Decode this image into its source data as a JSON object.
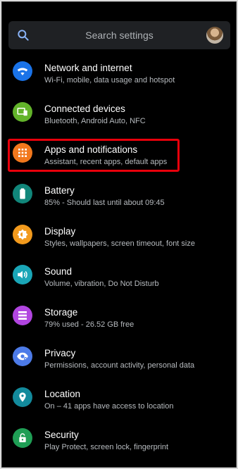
{
  "search": {
    "placeholder": "Search settings"
  },
  "items": [
    {
      "title": "Network and internet",
      "subtitle": "Wi-Fi, mobile, data usage and hotspot",
      "icon": "wifi-icon",
      "color": "#1a73e8"
    },
    {
      "title": "Connected devices",
      "subtitle": "Bluetooth, Android Auto, NFC",
      "icon": "connected-devices-icon",
      "color": "#62b32a"
    },
    {
      "title": "Apps and notifications",
      "subtitle": "Assistant, recent apps, default apps",
      "icon": "apps-grid-icon",
      "color": "#f2781d"
    },
    {
      "title": "Battery",
      "subtitle": "85% - Should last until about 09:45",
      "icon": "battery-icon",
      "color": "#11867a"
    },
    {
      "title": "Display",
      "subtitle": "Styles, wallpapers, screen timeout, font size",
      "icon": "brightness-icon",
      "color": "#f29a1d"
    },
    {
      "title": "Sound",
      "subtitle": "Volume, vibration, Do Not Disturb",
      "icon": "volume-icon",
      "color": "#1aa6b7"
    },
    {
      "title": "Storage",
      "subtitle": "79% used - 26.52 GB free",
      "icon": "storage-icon",
      "color": "#b145e0"
    },
    {
      "title": "Privacy",
      "subtitle": "Permissions, account activity, personal data",
      "icon": "privacy-eye-icon",
      "color": "#4d7be8"
    },
    {
      "title": "Location",
      "subtitle": "On – 41 apps have access to location",
      "icon": "location-pin-icon",
      "color": "#138a9c"
    },
    {
      "title": "Security",
      "subtitle": "Play Protect, screen lock, fingerprint",
      "icon": "lock-icon",
      "color": "#1f9e55"
    }
  ],
  "highlight_color": "#e8000b"
}
